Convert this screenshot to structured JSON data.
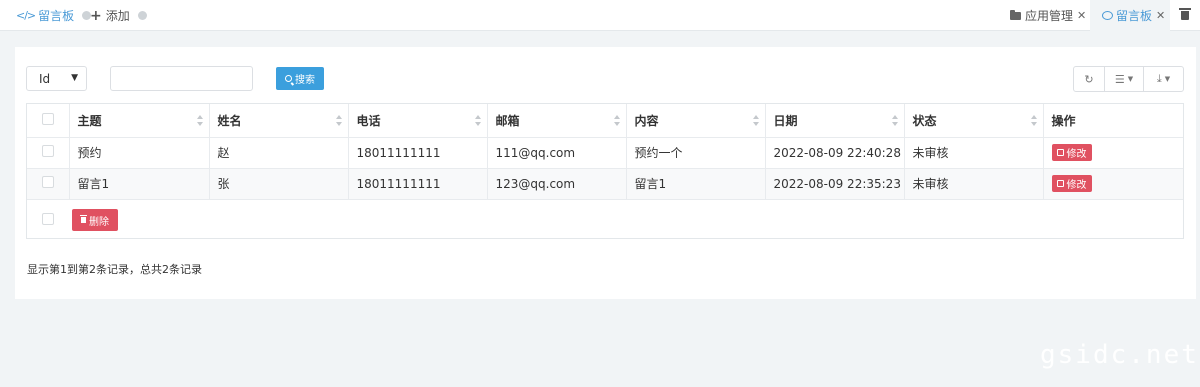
{
  "topbar": {
    "left_tabs": [
      {
        "label": "留言板"
      },
      {
        "label": "添加"
      }
    ],
    "right_tabs": [
      {
        "label": "应用管理"
      },
      {
        "label": "留言板"
      }
    ]
  },
  "toolbar": {
    "field_select": "Id",
    "search_input_value": "",
    "search_label": "搜索"
  },
  "table": {
    "headers": [
      "主题",
      "姓名",
      "电话",
      "邮箱",
      "内容",
      "日期",
      "状态",
      "操作"
    ],
    "rows": [
      {
        "subject": "预约",
        "name": "赵",
        "phone": "18011111111",
        "email": "111@qq.com",
        "content": "预约一个",
        "date": "2022-08-09 22:40:28",
        "status": "未审核",
        "action": "修改"
      },
      {
        "subject": "留言1",
        "name": "张",
        "phone": "18011111111",
        "email": "123@qq.com",
        "content": "留言1",
        "date": "2022-08-09 22:35:23",
        "status": "未审核",
        "action": "修改"
      }
    ],
    "delete_label": "删除"
  },
  "summary": "显示第1到第2条记录，总共2条记录",
  "watermark": "gsidc.net.cn",
  "colors": {
    "accent": "#3b9fdd",
    "danger": "#e05161",
    "tab_active": "#4a9ad6"
  }
}
